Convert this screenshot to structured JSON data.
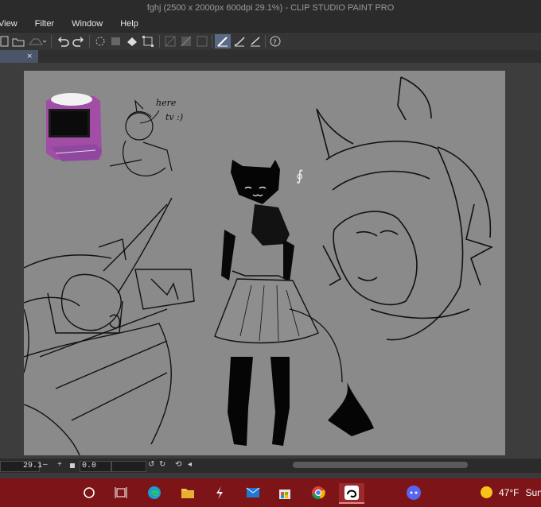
{
  "window": {
    "title": "fghj (2500 x 2000px 600dpi 29.1%)  - CLIP STUDIO PAINT PRO"
  },
  "menu": {
    "items": [
      "View",
      "Filter",
      "Window",
      "Help"
    ]
  },
  "toolbar": {
    "icons": [
      "new-icon",
      "open-icon",
      "save-icon",
      "undo-icon",
      "redo-icon",
      "loading-icon",
      "clear-icon",
      "fill-icon",
      "transform-icon",
      "snap-off-icon",
      "snap-ruler-icon",
      "snap-grid-icon",
      "stabilization-icon",
      "perspective-icon",
      "ruler-icon",
      "help-icon"
    ]
  },
  "tab": {
    "close_label": "×"
  },
  "statusbar": {
    "zoom_value": "29.1",
    "zoom_minus": "–",
    "zoom_plus": "+",
    "rotation_value": "0.0"
  },
  "taskbar": {
    "apps": [
      "start-icon",
      "task-view-icon",
      "edge-icon",
      "file-explorer-icon",
      "app-s-icon",
      "mail-icon",
      "store-icon",
      "chrome-icon",
      "clip-studio-icon",
      "discord-icon"
    ],
    "weather_temp": "47°F",
    "weather_text": "Sunny"
  },
  "canvas_art": {
    "handwriting_1": "here",
    "handwriting_2": "tv :)"
  },
  "colors": {
    "taskbar": "#7d1418",
    "canvas": "#8a8a8a",
    "tv_purple": "#a24ea6"
  }
}
